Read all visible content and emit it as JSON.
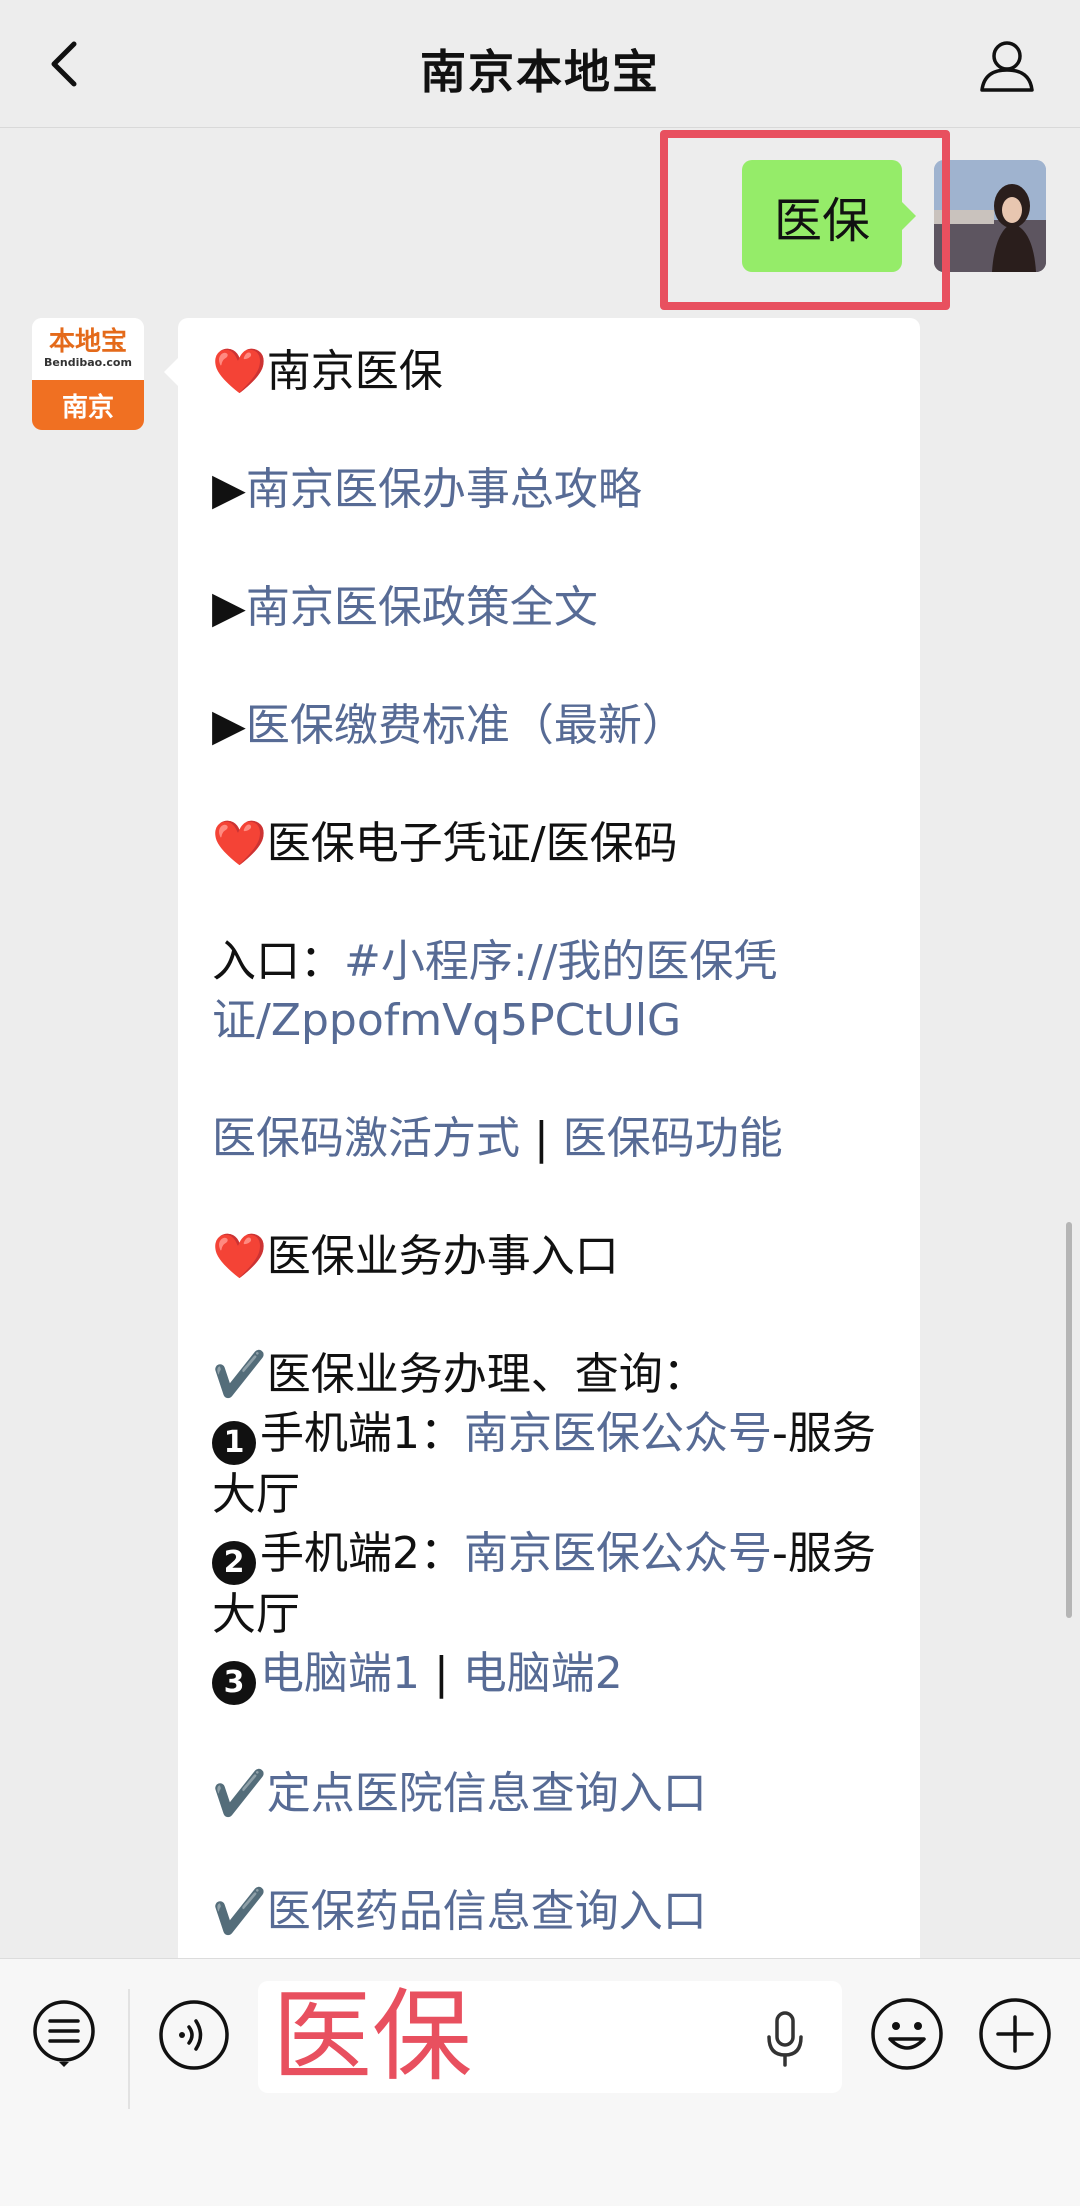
{
  "header": {
    "title": "南京本地宝"
  },
  "outgoing": {
    "text": "医保"
  },
  "bot_avatar": {
    "logo_text": "本地宝",
    "logo_sub": "Bendibao.com",
    "city": "南京"
  },
  "card": {
    "section1_title": "南京医保",
    "links1": [
      "南京医保办事总攻略",
      "南京医保政策全文",
      "医保缴费标准（最新）"
    ],
    "section2_title": "医保电子凭证/医保码",
    "entry_label": "入口：",
    "entry_link": "#小程序://我的医保凭证/ZppofmVq5PCtUlG",
    "code_link1": "医保码激活方式",
    "code_sep": " | ",
    "code_link2": "医保码功能",
    "section3_title": "医保业务办事入口",
    "business_label": "医保业务办理、查询：",
    "item1_label": "手机端1：",
    "item1_link": "南京医保公众号",
    "item1_suffix": "-服务大厅",
    "item2_label": "手机端2：",
    "item2_link": "南京医保公众号",
    "item2_suffix": "-服务大厅",
    "item3_link1": "电脑端1",
    "item3_sep": " | ",
    "item3_link2": "电脑端2",
    "hospital_link": "定点医院信息查询入口",
    "drug_link": "医保药品信息查询入口"
  },
  "input": {
    "value": "医保"
  },
  "colors": {
    "link": "#576b95",
    "bubble_out": "#95ec69",
    "highlight": "#e8505f",
    "brand_orange": "#f07022"
  }
}
